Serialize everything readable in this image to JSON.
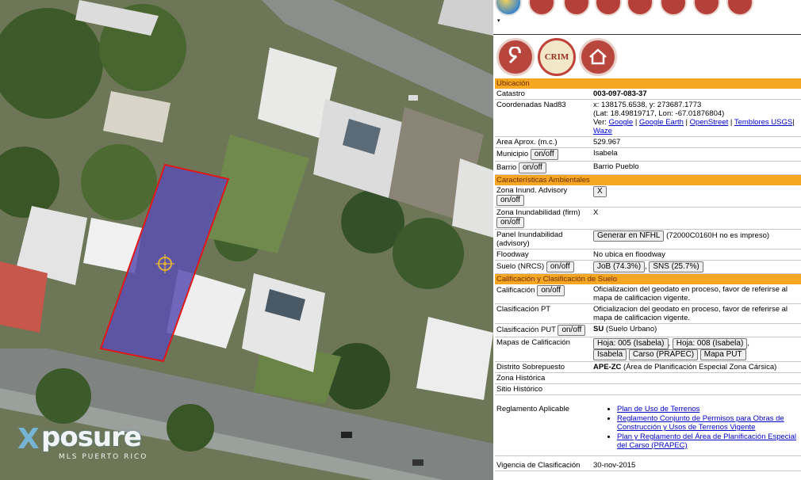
{
  "map": {
    "watermark": {
      "brand": "posure",
      "brand_prefix": "X",
      "sub": "MLS PUERTO RICO"
    },
    "parcel_outline_color": "#e01818",
    "parcel_fill_color": "#5a4fb0"
  },
  "toolbar": {
    "icons": [
      "globe-icon",
      "layers-icon",
      "layers-icon",
      "print-icon",
      "search-icon",
      "edit-icon",
      "printer-icon",
      "upload-icon"
    ],
    "dropdown_arrow": "▾"
  },
  "logos": [
    {
      "name": "tool-logo",
      "label": ""
    },
    {
      "name": "crim-logo",
      "label": "CRIM"
    },
    {
      "name": "house-logo",
      "label": ""
    }
  ],
  "sections": {
    "ubicacion": "Ubicación",
    "ambientales": "Características Ambientales",
    "calificacion": "Calificación y Clasificación de Suelo"
  },
  "rows": {
    "catastro": {
      "label": "Catastro",
      "value": "003-097-083-37"
    },
    "coordenadas": {
      "label": "Coordenadas Nad83",
      "line1": "x: 138175.6538, y: 273687.1773",
      "line2": "(Lat: 18.49819717, Lon: -67.01876804)",
      "ver": "Ver:",
      "links": [
        "Google",
        "Google Earth",
        "OpenStreet",
        "Temblores USGS",
        "Waze"
      ]
    },
    "area": {
      "label": "Area Aprox. (m.c.)",
      "value": "529.967"
    },
    "municipio": {
      "label": "Municipio",
      "button": "on/off",
      "value": "Isabela"
    },
    "barrio": {
      "label": "Barrio",
      "button": "on/off",
      "value": "Barrio Pueblo"
    },
    "zona_inund_adv": {
      "label": "Zona Inund. Advisory",
      "button": "on/off",
      "value_button": "X"
    },
    "zona_inund_firm": {
      "label": "Zona Inundabilidad (firm)",
      "button": "on/off",
      "value": "X"
    },
    "panel_inund": {
      "label": "Panel Inundabilidad (advisory)",
      "button": "Generar en NFHL",
      "value": "(72000C0160H no es impreso)"
    },
    "floodway": {
      "label": "Floodway",
      "value": "No ubica en floodway"
    },
    "suelo": {
      "label": "Suelo (NRCS)",
      "button": "on/off",
      "soil1": "JoB (74.3%)",
      "soil2": "SNS (25.7%)"
    },
    "calificacion": {
      "label": "Calificación",
      "button": "on/off",
      "value": "Oficializacion del geodato en proceso, favor de referirse al mapa de calificacion vigente."
    },
    "clasificacion_pt": {
      "label": "Clasificación PT",
      "value": "Oficializacion del geodato en proceso, favor de referirse al mapa de calificacion vigente."
    },
    "clasificacion_put": {
      "label": "Clasificación PUT",
      "button": "on/off",
      "code": "SU",
      "value": "(Suelo Urbano)"
    },
    "mapas": {
      "label": "Mapas de Calificación",
      "buttons": [
        "Hoja: 005 (Isabela)",
        "Hoja: 008 (Isabela)",
        "Isabela",
        "Carso (PRAPEC)",
        "Mapa PUT"
      ]
    },
    "distrito": {
      "label": "Distrito Sobrepuesto",
      "code": "APE-ZC",
      "value": "(Área de Planificación Especial Zona Cársica)"
    },
    "zona_historica": {
      "label": "Zona Histórica",
      "value": ""
    },
    "sitio_historico": {
      "label": "Sitio Histórico",
      "value": ""
    },
    "reglamento": {
      "label": "Reglamento Aplicable",
      "links": [
        "Plan de Uso de Terrenos",
        "Reglamento Conjunto de Permisos para Obras de Construcción y Usos de Terrenos Vigente",
        "Plan y Reglamento del Área de Planificación Especial del Carso (PRAPEC)"
      ]
    },
    "vigencia": {
      "label": "Vigencia de Clasificación",
      "value": "30-nov-2015"
    }
  }
}
